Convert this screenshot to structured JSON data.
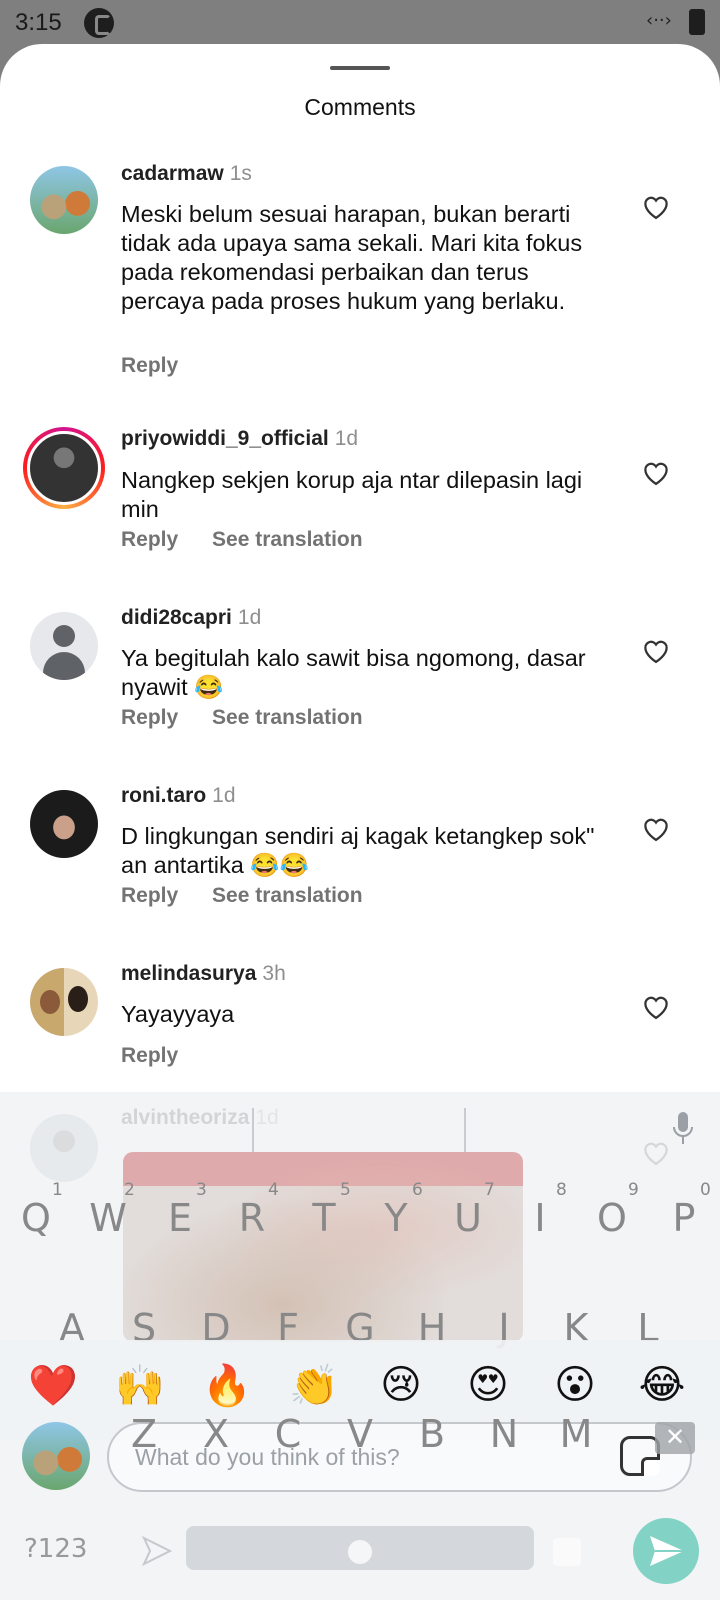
{
  "status_bar": {
    "time": "3:15",
    "signal_glyph": "‹··›"
  },
  "sheet": {
    "title": "Comments"
  },
  "comments": [
    {
      "username": "cadarmaw",
      "time": "1s",
      "text": "Meski belum sesuai harapan, bukan berarti tidak ada upaya sama sekali. Mari kita fokus pada rekomendasi perbaikan dan terus percaya pada proses hukum yang berlaku.",
      "reply": "Reply"
    },
    {
      "username": "priyowiddi_9_official",
      "time": "1d",
      "text": "Nangkep sekjen korup aja ntar dilepasin lagi min",
      "reply": "Reply",
      "translate": "See translation"
    },
    {
      "username": "didi28capri",
      "time": "1d",
      "text": "Ya begitulah kalo sawit bisa ngomong, dasar nyawit 😂",
      "reply": "Reply",
      "translate": "See translation"
    },
    {
      "username": "roni.taro",
      "time": "1d",
      "text": "D lingkungan sendiri aj kagak ketangkep sok\" an antartika 😂😂",
      "reply": "Reply",
      "translate": "See translation"
    },
    {
      "username": "melindasurya",
      "time": "3h",
      "text": "Yayayyaya",
      "reply": "Reply"
    },
    {
      "username": "alvintheoriza",
      "time": "1d"
    }
  ],
  "emoji_bar": [
    "❤️",
    "🙌",
    "🔥",
    "👏",
    "😢",
    "😍",
    "😮",
    "😂"
  ],
  "composer": {
    "placeholder": "What do you think of this?"
  },
  "keyboard": {
    "numbers": [
      "1",
      "2",
      "3",
      "4",
      "5",
      "6",
      "7",
      "8",
      "9",
      "0"
    ],
    "row1": [
      "Q",
      "W",
      "E",
      "R",
      "T",
      "Y",
      "U",
      "I",
      "O",
      "P"
    ],
    "row2": [
      "A",
      "S",
      "D",
      "F",
      "G",
      "H",
      "J",
      "K",
      "L"
    ],
    "row3": [
      "Z",
      "X",
      "C",
      "V",
      "B",
      "N",
      "M"
    ],
    "symbols_label": "?123",
    "delete_glyph": "✕"
  },
  "colors": {
    "send_button": "#82d3c5",
    "username": "#222222",
    "meta_grey": "#8e8e8e"
  }
}
